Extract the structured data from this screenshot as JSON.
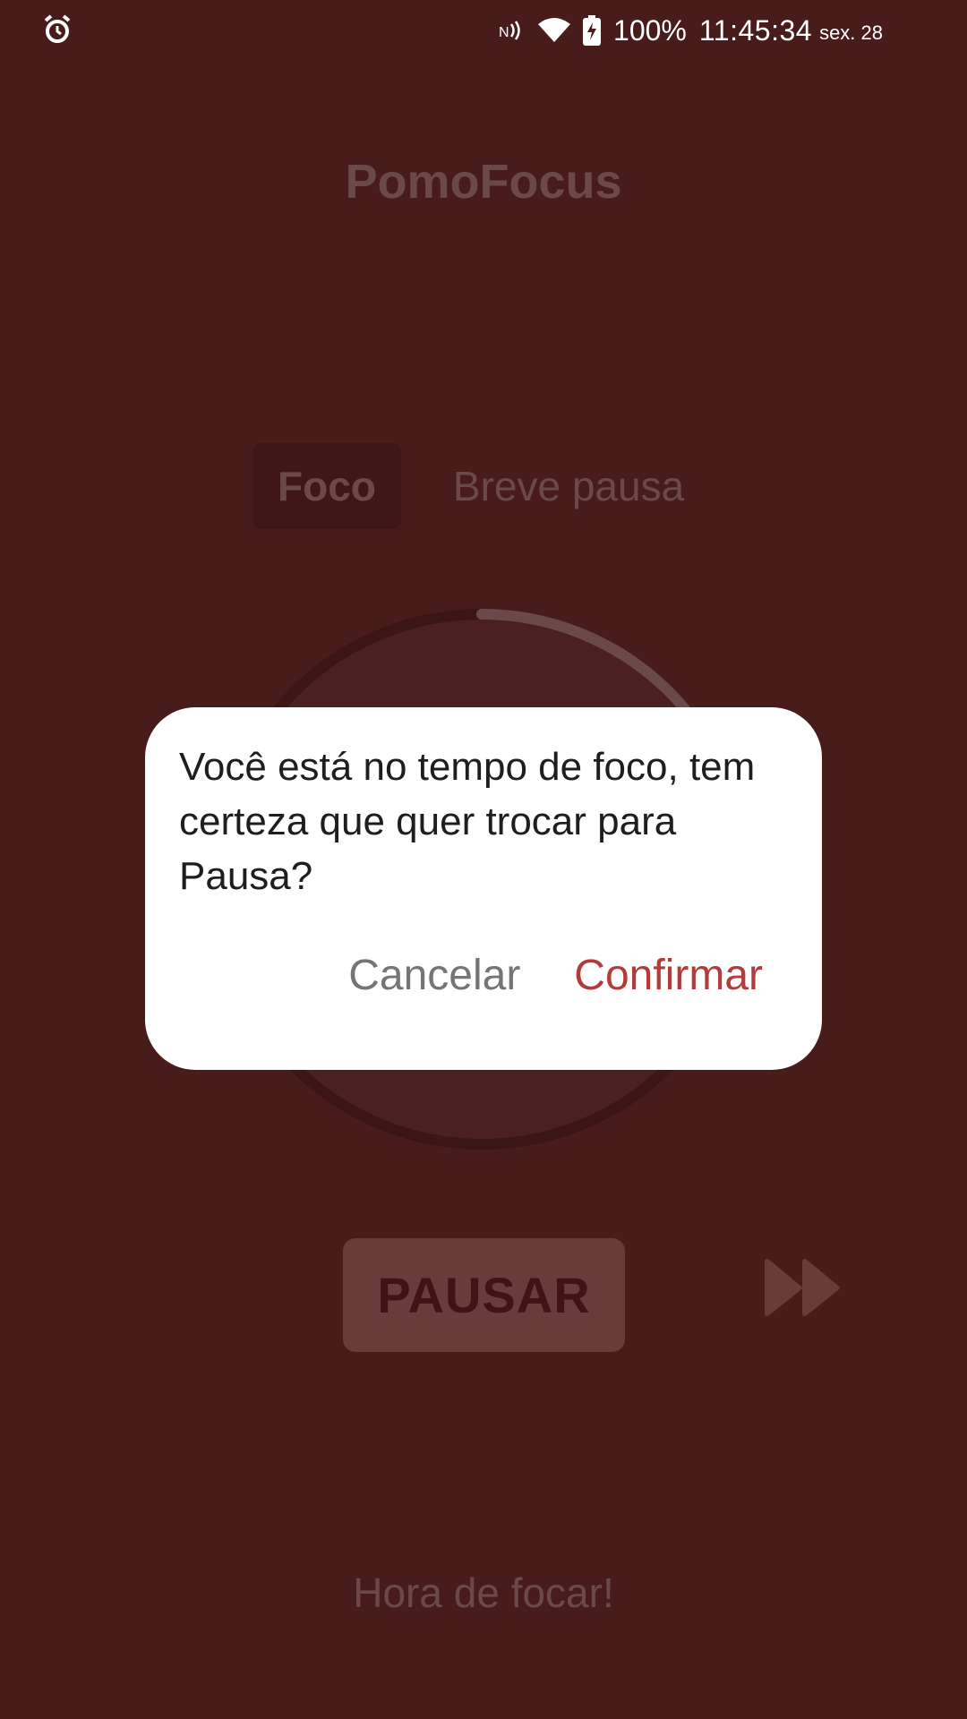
{
  "status_bar": {
    "alarm_icon": "alarm-clock-icon",
    "nfc_icon": "nfc-icon",
    "wifi_icon": "wifi-icon",
    "battery_icon": "battery-charging-icon",
    "battery_percent": "100%",
    "time": "11:45:34",
    "date": "sex. 28"
  },
  "app": {
    "title": "PomoFocus",
    "tabs": [
      {
        "label": "Foco",
        "active": true
      },
      {
        "label": "Breve pausa",
        "active": false
      }
    ],
    "pause_label": "PAUSAR",
    "skip_icon": "fast-forward-icon",
    "footer_message": "Hora de focar!",
    "timer_progress": 0.02
  },
  "dialog": {
    "message": "Você está no tempo de foco, tem certeza que quer trocar para Pausa?",
    "cancel_label": "Cancelar",
    "confirm_label": "Confirmar"
  },
  "colors": {
    "background": "#491c1c",
    "dialog_bg": "#ffffff",
    "confirm_accent": "#b23b3b",
    "cancel_text": "#757575"
  }
}
